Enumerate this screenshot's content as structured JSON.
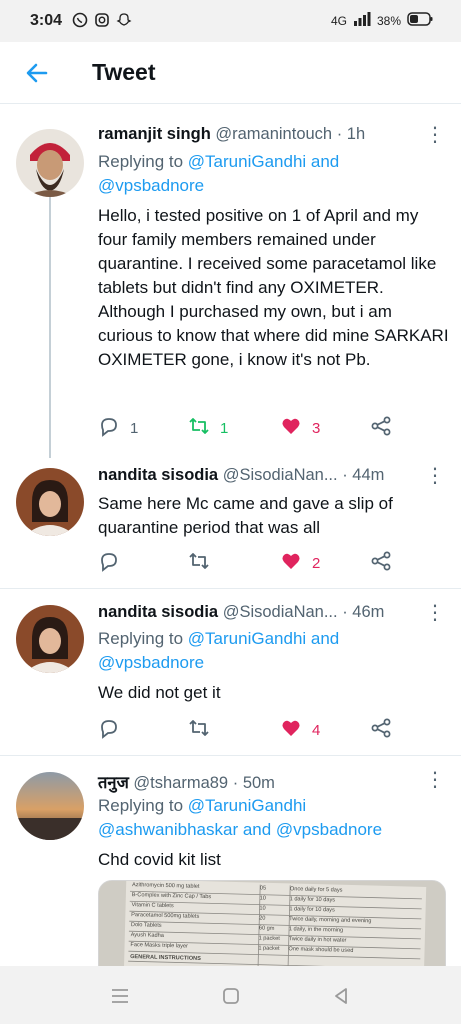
{
  "status_bar": {
    "time": "3:04",
    "network": "4G",
    "battery": "38%"
  },
  "header": {
    "title": "Tweet",
    "back_icon": "arrow-left-icon"
  },
  "colors": {
    "accent": "#1d9bf0",
    "like": "#e0245e",
    "retweet": "#17bf63"
  },
  "tweets": [
    {
      "name": "ramanjit singh",
      "handle": "@ramanintouch",
      "dot": "·",
      "age": "1h",
      "reply_prefix": "Replying to",
      "reply_links": "@TaruniGandhi and @vpsbadnore",
      "text": "Hello, i tested positive on 1 of April and my four family members remained under quarantine. I received some paracetamol like tablets but didn't find any OXIMETER. Although I purchased my own, but i am curious to know that where did mine SARKARI OXIMETER gone, i know it's not Pb.",
      "replies": "1",
      "retweets": "1",
      "likes": "3"
    },
    {
      "name": "nandita sisodia",
      "handle": "@SisodiaNan...",
      "dot": "·",
      "age": "44m",
      "text": "Same here Mc came and gave a slip of quarantine period that was all",
      "replies": "",
      "retweets": "",
      "likes": "2"
    },
    {
      "name": "nandita sisodia",
      "handle": "@SisodiaNan...",
      "dot": "·",
      "age": "46m",
      "reply_prefix": "Replying to",
      "reply_links": "@TaruniGandhi and @vpsbadnore",
      "text": "We did not get it",
      "replies": "",
      "retweets": "",
      "likes": "4"
    },
    {
      "name": "तनुज",
      "handle": "@tsharma89",
      "dot": "·",
      "age": "50m",
      "reply_prefix": "Replying to",
      "reply_links": "@TaruniGandhi @ashwanibhaskar and @vpsbadnore",
      "text": "Chd covid kit list"
    }
  ],
  "media": {
    "rows": [
      [
        "Azithromycin 500 mg tablet",
        "05",
        "Once daily for 5 days"
      ],
      [
        "B-Complex with Zinc Cap / Tabs",
        "10",
        "1 daily for 10 days"
      ],
      [
        "Vitamin C tablets",
        "10",
        "1 daily for 10 days"
      ],
      [
        "Paracetamol 500mg tablets",
        "20",
        "Twice daily, morning and evening"
      ],
      [
        "Dolo Tablets",
        "60 gm",
        "1 daily, in the morning"
      ],
      [
        "Ayush Kadha",
        "1 packet",
        "Twice daily in hot water"
      ],
      [
        "Face Masks triple layer",
        "1 packet",
        "One mask should be used"
      ]
    ],
    "footer": "GENERAL INSTRUCTIONS"
  }
}
